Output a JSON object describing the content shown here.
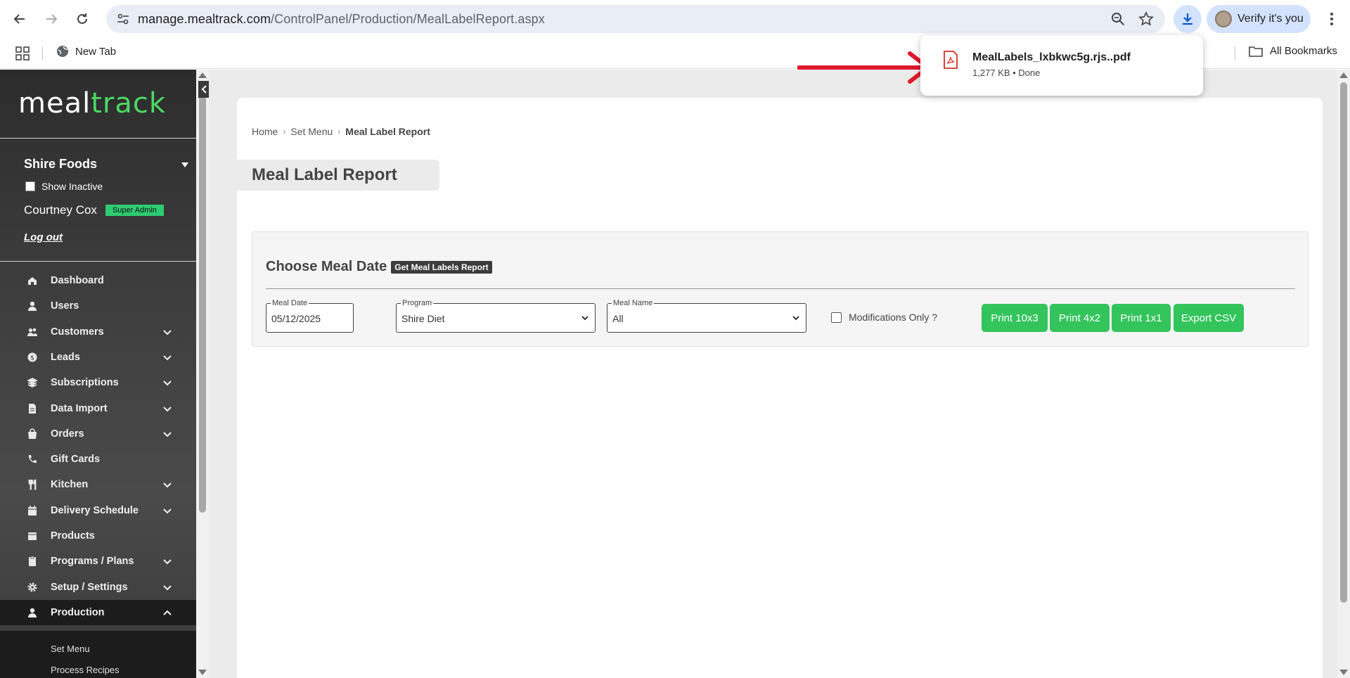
{
  "browser": {
    "url_host": "manage.mealtrack.com",
    "url_path": "/ControlPanel/Production/MealLabelReport.aspx",
    "profile_label": "Verify it's you",
    "bookmark_new_tab": "New Tab",
    "bookmark_all": "All Bookmarks"
  },
  "download": {
    "filename": "MealLabels_lxbkwc5g.rjs..pdf",
    "meta": "1,277 KB • Done"
  },
  "sidebar": {
    "logo_meal": "meal",
    "logo_track": "track",
    "org": "Shire Foods",
    "show_inactive": "Show Inactive",
    "user_name": "Courtney Cox",
    "role": "Super Admin",
    "logout": "Log out",
    "items": [
      {
        "label": "Dashboard",
        "icon": "home-icon",
        "expandable": false
      },
      {
        "label": "Users",
        "icon": "user-icon",
        "expandable": false
      },
      {
        "label": "Customers",
        "icon": "users-icon",
        "expandable": true
      },
      {
        "label": "Leads",
        "icon": "dollar-icon",
        "expandable": true
      },
      {
        "label": "Subscriptions",
        "icon": "layers-icon",
        "expandable": true
      },
      {
        "label": "Data Import",
        "icon": "file-icon",
        "expandable": true
      },
      {
        "label": "Orders",
        "icon": "bag-icon",
        "expandable": true
      },
      {
        "label": "Gift Cards",
        "icon": "phone-icon",
        "expandable": false
      },
      {
        "label": "Kitchen",
        "icon": "utensils-icon",
        "expandable": true
      },
      {
        "label": "Delivery Schedule",
        "icon": "calendar-icon",
        "expandable": true
      },
      {
        "label": "Products",
        "icon": "box-icon",
        "expandable": false
      },
      {
        "label": "Programs / Plans",
        "icon": "clipboard-icon",
        "expandable": true
      },
      {
        "label": "Setup / Settings",
        "icon": "gear-icon",
        "expandable": true
      },
      {
        "label": "Production",
        "icon": "user-icon",
        "expandable": true,
        "active": true
      }
    ],
    "subitems": [
      "Set Menu",
      "Process Recipes"
    ]
  },
  "page": {
    "breadcrumb": [
      "Home",
      "Set Menu",
      "Meal Label Report"
    ],
    "title": "Meal Label Report",
    "panel_heading": "Choose Meal Date",
    "panel_badge": "Get Meal Labels Report",
    "meal_date_label": "Meal Date",
    "meal_date_value": "05/12/2025",
    "program_label": "Program",
    "program_value": "Shire Diet",
    "meal_name_label": "Meal Name",
    "meal_name_value": "All",
    "modifications_label": "Modifications Only ?",
    "buttons": [
      "Print 10x3",
      "Print 4x2",
      "Print 1x1",
      "Export CSV"
    ]
  },
  "colors": {
    "accent_green": "#33c45c",
    "logo_green": "#4cd964",
    "arrow_red": "#e0182d"
  }
}
